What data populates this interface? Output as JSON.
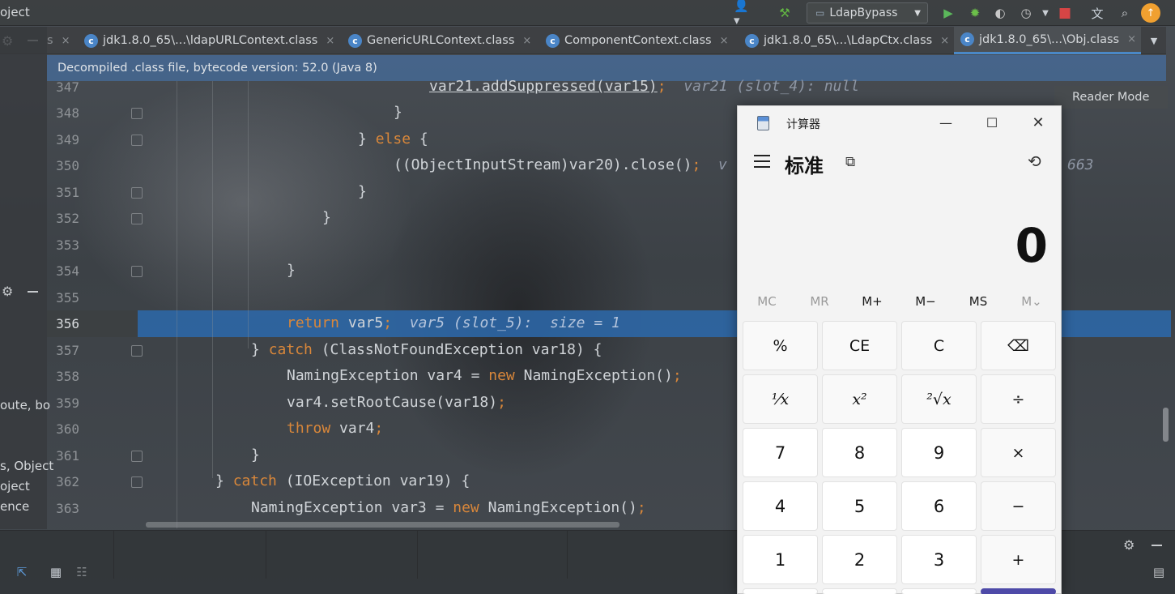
{
  "topbar": {
    "project_label": "oject",
    "run_config": "LdapBypass"
  },
  "tabs": [
    {
      "label": "s",
      "closable": true
    },
    {
      "label": "jdk1.8.0_65\\...\\ldapURLContext.class"
    },
    {
      "label": "GenericURLContext.class"
    },
    {
      "label": "ComponentContext.class"
    },
    {
      "label": "jdk1.8.0_65\\...\\LdapCtx.class"
    },
    {
      "label": "jdk1.8.0_65\\...\\Obj.class"
    }
  ],
  "tab_close_glyph": "×",
  "tab_icon_letter": "c",
  "banner": "Decompiled .class file, bytecode version: 52.0 (Java 8)",
  "reader_mode": "Reader Mode",
  "left_fragments": [
    "oute, bo",
    "s, Object",
    "oject",
    "ence"
  ],
  "editor": {
    "line_numbers": [
      "347",
      "348",
      "349",
      "350",
      "351",
      "352",
      "353",
      "354",
      "355",
      "356",
      "357",
      "358",
      "359",
      "360",
      "361",
      "362",
      "363"
    ],
    "line347": {
      "code": "var21.addSuppressed(var15)",
      "semi": ";",
      "debug": "var21 (slot_4): null"
    },
    "line348": "}",
    "line349": {
      "brace": "} ",
      "kw": "else",
      "rest": " {"
    },
    "line350": {
      "code": "((ObjectInputStream)var20).close()",
      "semi": ";",
      "debug": "v",
      "tail": "663"
    },
    "line351": "}",
    "line352": "}",
    "line354": "}",
    "line356": {
      "kw": "return",
      "code": " var5",
      "semi": ";",
      "debug": "var5 (slot_5):  size = 1"
    },
    "line357": {
      "brace": "} ",
      "kw": "catch",
      "rest": " (ClassNotFoundException var18) {"
    },
    "line358": {
      "code": "NamingException var4 = ",
      "kw": "new",
      "rest": " NamingException()",
      "semi": ";"
    },
    "line359": {
      "code": "var4.setRootCause(var18)",
      "semi": ";"
    },
    "line360": {
      "kw": "throw",
      "code": " var4",
      "semi": ";"
    },
    "line361": "}",
    "line362": {
      "brace": "} ",
      "kw": "catch",
      "rest": " (IOException var19) {"
    },
    "line363": {
      "code": "NamingException var3 = ",
      "kw": "new",
      "rest": " NamingException()",
      "semi": ";"
    }
  },
  "calculator": {
    "title": "计算器",
    "mode": "标准",
    "display": "0",
    "memory": [
      "MC",
      "MR",
      "M+",
      "M−",
      "MS",
      "M⌄"
    ],
    "keys": [
      [
        "%",
        "CE",
        "C",
        "⌫"
      ],
      [
        "¹⁄x",
        "x²",
        "²√x",
        "÷"
      ],
      [
        "7",
        "8",
        "9",
        "×"
      ],
      [
        "4",
        "5",
        "6",
        "−"
      ],
      [
        "1",
        "2",
        "3",
        "+"
      ]
    ],
    "accent_color": "#4e4aa8"
  },
  "colors": {
    "keyword": "#d9873a",
    "highlight_row": "#2c68a8",
    "banner": "#466a96"
  }
}
